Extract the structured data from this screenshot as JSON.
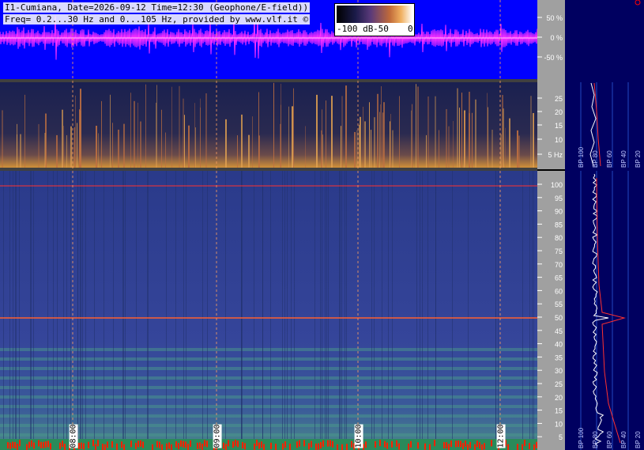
{
  "header": {
    "line1": "I1-Cumiana, Date=2026-09-12 Time=12:30 (Geophone/E-field))",
    "line2": "Freq= 0.2...30 Hz and 0...105 Hz, provided by www.vlf.it ©"
  },
  "colorbar": {
    "labels": [
      "-100 dB",
      "-50",
      "0"
    ]
  },
  "amplitude_axis": {
    "ticks": [
      "50 %",
      "0 %",
      "-50 %"
    ]
  },
  "upper_axis": {
    "ticks": [
      "25",
      "20",
      "15",
      "10",
      "5 Hz"
    ]
  },
  "lower_axis": {
    "ticks": [
      "100",
      "95",
      "90",
      "85",
      "80",
      "75",
      "70",
      "65",
      "60",
      "55",
      "50",
      "45",
      "40",
      "35",
      "30",
      "25",
      "20",
      "15",
      "10",
      "5"
    ]
  },
  "time_labels": [
    "08:00",
    "09:00",
    "10:00",
    "12:00"
  ],
  "spectrum_upper_labels": [
    "BP 100",
    "BP 80",
    "BP 60",
    "BP 40",
    "BP 20"
  ],
  "spectrum_lower_labels": [
    "BP 100",
    "BP 80",
    "BP 60",
    "BP 40",
    "BP 20"
  ],
  "colors": {
    "wave": "#ff30ff",
    "wave_bg": "#0000ff",
    "spec_bg": "#000060",
    "accent": "#ff0000"
  }
}
